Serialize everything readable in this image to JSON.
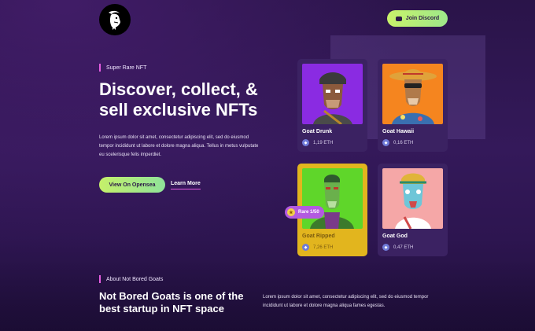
{
  "header": {
    "logo_icon": "goat-logo-icon",
    "join_discord_label": "Join Discord",
    "discord_icon": "discord-icon"
  },
  "hero": {
    "tag": "Super Rare NFT",
    "title": "Discover, collect, & sell exclusive NFTs",
    "text": "Lorem ipsum dolor sit amet, consectetur adipiscing elit, sed do eiusmod tempor incididunt ut labore et dolore magna aliqua. Tellus in metus vulputate eu scelerisque felis imperdiet.",
    "primary_button": "View On Opensea",
    "secondary_link": "Learn More"
  },
  "cards": [
    {
      "name": "Goat Drunk",
      "price": "1,19 ETH",
      "bg_color": "#8a2be2"
    },
    {
      "name": "Goat Hawaii",
      "price": "0,16 ETH",
      "bg_color": "#f5851f"
    },
    {
      "name": "Goat Ripped",
      "price": "7,26 ETH",
      "bg_color": "#5fd62a"
    },
    {
      "name": "Goat God",
      "price": "0,47 ETH",
      "bg_color": "#f5a7a7"
    }
  ],
  "rare_badge": "Rare 1/50",
  "about": {
    "tag": "About Not Bored Goats",
    "title": "Not Bored Goats is one of the best startup in NFT space",
    "text": "Lorem ipsum dolor sit amet, consectetur adipiscing elit, sed do eiusmod tempor incididunt ut labore et dolore magna aliqua fames egestas."
  },
  "colors": {
    "accent_green": "#c5f06a",
    "accent_pink": "#e45ce0",
    "card_bg": "#3b2262",
    "gold": "#e2b51e"
  }
}
